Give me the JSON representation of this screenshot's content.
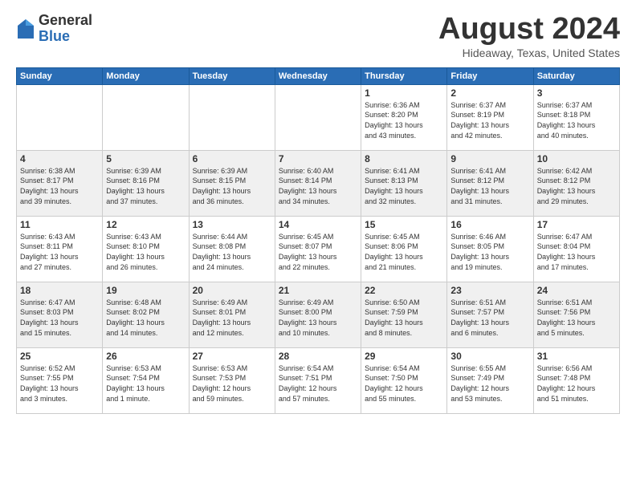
{
  "logo": {
    "general": "General",
    "blue": "Blue"
  },
  "header": {
    "month_year": "August 2024",
    "location": "Hideaway, Texas, United States"
  },
  "weekdays": [
    "Sunday",
    "Monday",
    "Tuesday",
    "Wednesday",
    "Thursday",
    "Friday",
    "Saturday"
  ],
  "rows": [
    [
      {
        "day": "",
        "text": ""
      },
      {
        "day": "",
        "text": ""
      },
      {
        "day": "",
        "text": ""
      },
      {
        "day": "",
        "text": ""
      },
      {
        "day": "1",
        "text": "Sunrise: 6:36 AM\nSunset: 8:20 PM\nDaylight: 13 hours\nand 43 minutes."
      },
      {
        "day": "2",
        "text": "Sunrise: 6:37 AM\nSunset: 8:19 PM\nDaylight: 13 hours\nand 42 minutes."
      },
      {
        "day": "3",
        "text": "Sunrise: 6:37 AM\nSunset: 8:18 PM\nDaylight: 13 hours\nand 40 minutes."
      }
    ],
    [
      {
        "day": "4",
        "text": "Sunrise: 6:38 AM\nSunset: 8:17 PM\nDaylight: 13 hours\nand 39 minutes."
      },
      {
        "day": "5",
        "text": "Sunrise: 6:39 AM\nSunset: 8:16 PM\nDaylight: 13 hours\nand 37 minutes."
      },
      {
        "day": "6",
        "text": "Sunrise: 6:39 AM\nSunset: 8:15 PM\nDaylight: 13 hours\nand 36 minutes."
      },
      {
        "day": "7",
        "text": "Sunrise: 6:40 AM\nSunset: 8:14 PM\nDaylight: 13 hours\nand 34 minutes."
      },
      {
        "day": "8",
        "text": "Sunrise: 6:41 AM\nSunset: 8:13 PM\nDaylight: 13 hours\nand 32 minutes."
      },
      {
        "day": "9",
        "text": "Sunrise: 6:41 AM\nSunset: 8:12 PM\nDaylight: 13 hours\nand 31 minutes."
      },
      {
        "day": "10",
        "text": "Sunrise: 6:42 AM\nSunset: 8:12 PM\nDaylight: 13 hours\nand 29 minutes."
      }
    ],
    [
      {
        "day": "11",
        "text": "Sunrise: 6:43 AM\nSunset: 8:11 PM\nDaylight: 13 hours\nand 27 minutes."
      },
      {
        "day": "12",
        "text": "Sunrise: 6:43 AM\nSunset: 8:10 PM\nDaylight: 13 hours\nand 26 minutes."
      },
      {
        "day": "13",
        "text": "Sunrise: 6:44 AM\nSunset: 8:08 PM\nDaylight: 13 hours\nand 24 minutes."
      },
      {
        "day": "14",
        "text": "Sunrise: 6:45 AM\nSunset: 8:07 PM\nDaylight: 13 hours\nand 22 minutes."
      },
      {
        "day": "15",
        "text": "Sunrise: 6:45 AM\nSunset: 8:06 PM\nDaylight: 13 hours\nand 21 minutes."
      },
      {
        "day": "16",
        "text": "Sunrise: 6:46 AM\nSunset: 8:05 PM\nDaylight: 13 hours\nand 19 minutes."
      },
      {
        "day": "17",
        "text": "Sunrise: 6:47 AM\nSunset: 8:04 PM\nDaylight: 13 hours\nand 17 minutes."
      }
    ],
    [
      {
        "day": "18",
        "text": "Sunrise: 6:47 AM\nSunset: 8:03 PM\nDaylight: 13 hours\nand 15 minutes."
      },
      {
        "day": "19",
        "text": "Sunrise: 6:48 AM\nSunset: 8:02 PM\nDaylight: 13 hours\nand 14 minutes."
      },
      {
        "day": "20",
        "text": "Sunrise: 6:49 AM\nSunset: 8:01 PM\nDaylight: 13 hours\nand 12 minutes."
      },
      {
        "day": "21",
        "text": "Sunrise: 6:49 AM\nSunset: 8:00 PM\nDaylight: 13 hours\nand 10 minutes."
      },
      {
        "day": "22",
        "text": "Sunrise: 6:50 AM\nSunset: 7:59 PM\nDaylight: 13 hours\nand 8 minutes."
      },
      {
        "day": "23",
        "text": "Sunrise: 6:51 AM\nSunset: 7:57 PM\nDaylight: 13 hours\nand 6 minutes."
      },
      {
        "day": "24",
        "text": "Sunrise: 6:51 AM\nSunset: 7:56 PM\nDaylight: 13 hours\nand 5 minutes."
      }
    ],
    [
      {
        "day": "25",
        "text": "Sunrise: 6:52 AM\nSunset: 7:55 PM\nDaylight: 13 hours\nand 3 minutes."
      },
      {
        "day": "26",
        "text": "Sunrise: 6:53 AM\nSunset: 7:54 PM\nDaylight: 13 hours\nand 1 minute."
      },
      {
        "day": "27",
        "text": "Sunrise: 6:53 AM\nSunset: 7:53 PM\nDaylight: 12 hours\nand 59 minutes."
      },
      {
        "day": "28",
        "text": "Sunrise: 6:54 AM\nSunset: 7:51 PM\nDaylight: 12 hours\nand 57 minutes."
      },
      {
        "day": "29",
        "text": "Sunrise: 6:54 AM\nSunset: 7:50 PM\nDaylight: 12 hours\nand 55 minutes."
      },
      {
        "day": "30",
        "text": "Sunrise: 6:55 AM\nSunset: 7:49 PM\nDaylight: 12 hours\nand 53 minutes."
      },
      {
        "day": "31",
        "text": "Sunrise: 6:56 AM\nSunset: 7:48 PM\nDaylight: 12 hours\nand 51 minutes."
      }
    ]
  ]
}
